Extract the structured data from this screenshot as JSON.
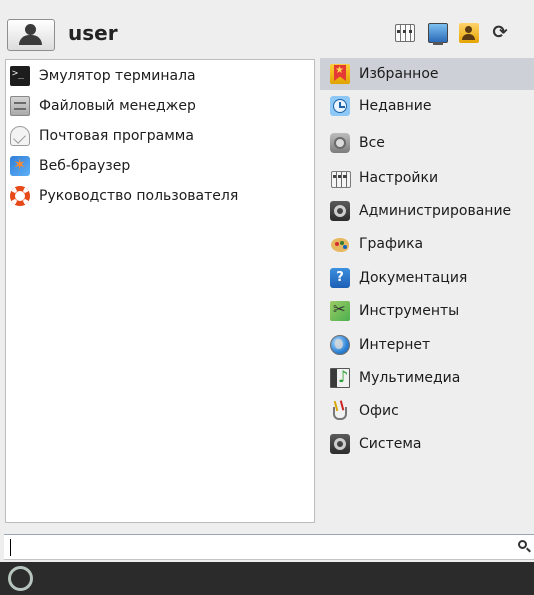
{
  "header": {
    "username": "user",
    "power_glyph": "⟳"
  },
  "favorites": {
    "items": [
      {
        "label": "Эмулятор терминала",
        "icon": "terminal-icon"
      },
      {
        "label": "Файловый менеджер",
        "icon": "file-manager-icon"
      },
      {
        "label": "Почтовая программа",
        "icon": "mail-icon"
      },
      {
        "label": "Веб-браузер",
        "icon": "web-browser-icon"
      },
      {
        "label": "Руководство пользователя",
        "icon": "help-lifebuoy-icon"
      }
    ]
  },
  "categories": {
    "active_index": 0,
    "items": [
      {
        "label": "Избранное",
        "icon": "favorites-icon"
      },
      {
        "label": "Недавние",
        "icon": "recent-icon"
      },
      {
        "label": "Все",
        "icon": "all-apps-icon"
      },
      {
        "label": "Настройки",
        "icon": "settings-icon"
      },
      {
        "label": "Администрирование",
        "icon": "administration-icon"
      },
      {
        "label": "Графика",
        "icon": "graphics-icon"
      },
      {
        "label": "Документация",
        "icon": "documentation-icon"
      },
      {
        "label": "Инструменты",
        "icon": "tools-icon"
      },
      {
        "label": "Интернет",
        "icon": "internet-icon"
      },
      {
        "label": "Мультимедиа",
        "icon": "multimedia-icon"
      },
      {
        "label": "Офис",
        "icon": "office-icon"
      },
      {
        "label": "Система",
        "icon": "system-icon"
      }
    ]
  },
  "search": {
    "value": "",
    "placeholder": ""
  },
  "colors": {
    "background": "#eeeeee",
    "panel": "#ffffff",
    "active_category": "#cdd0d6",
    "taskbar": "#2b2b2b"
  }
}
